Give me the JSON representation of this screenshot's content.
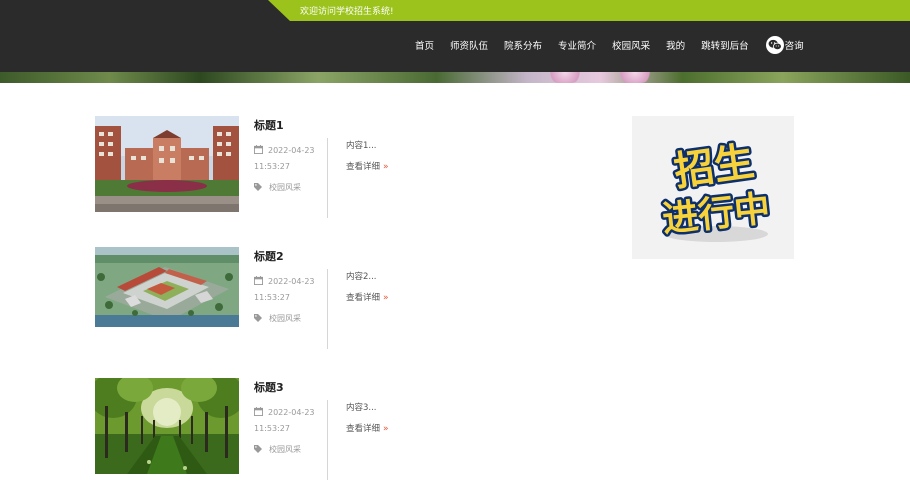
{
  "header": {
    "welcome": "欢迎访问学校招生系统!",
    "accent_color": "#9cc21c",
    "nav": [
      {
        "label": "首页"
      },
      {
        "label": "师资队伍"
      },
      {
        "label": "院系分布"
      },
      {
        "label": "专业简介"
      },
      {
        "label": "校园风采"
      },
      {
        "label": "我的"
      },
      {
        "label": "跳转到后台"
      }
    ],
    "consult_label": "咨询",
    "consult_icon": "wechat-icon"
  },
  "posts": [
    {
      "title": "标题1",
      "date": "2022-04-23",
      "time": "11:53:27",
      "tag": "校园风采",
      "excerpt": "内容1...",
      "more": "查看详细"
    },
    {
      "title": "标题2",
      "date": "2022-04-23",
      "time": "11:53:27",
      "tag": "校园风采",
      "excerpt": "内容2...",
      "more": "查看详细"
    },
    {
      "title": "标题3",
      "date": "2022-04-23",
      "time": "11:53:27",
      "tag": "校园风采",
      "excerpt": "内容3...",
      "more": "查看详细"
    }
  ],
  "ad": {
    "text_line1": "招生",
    "text_line2": "进行中"
  }
}
